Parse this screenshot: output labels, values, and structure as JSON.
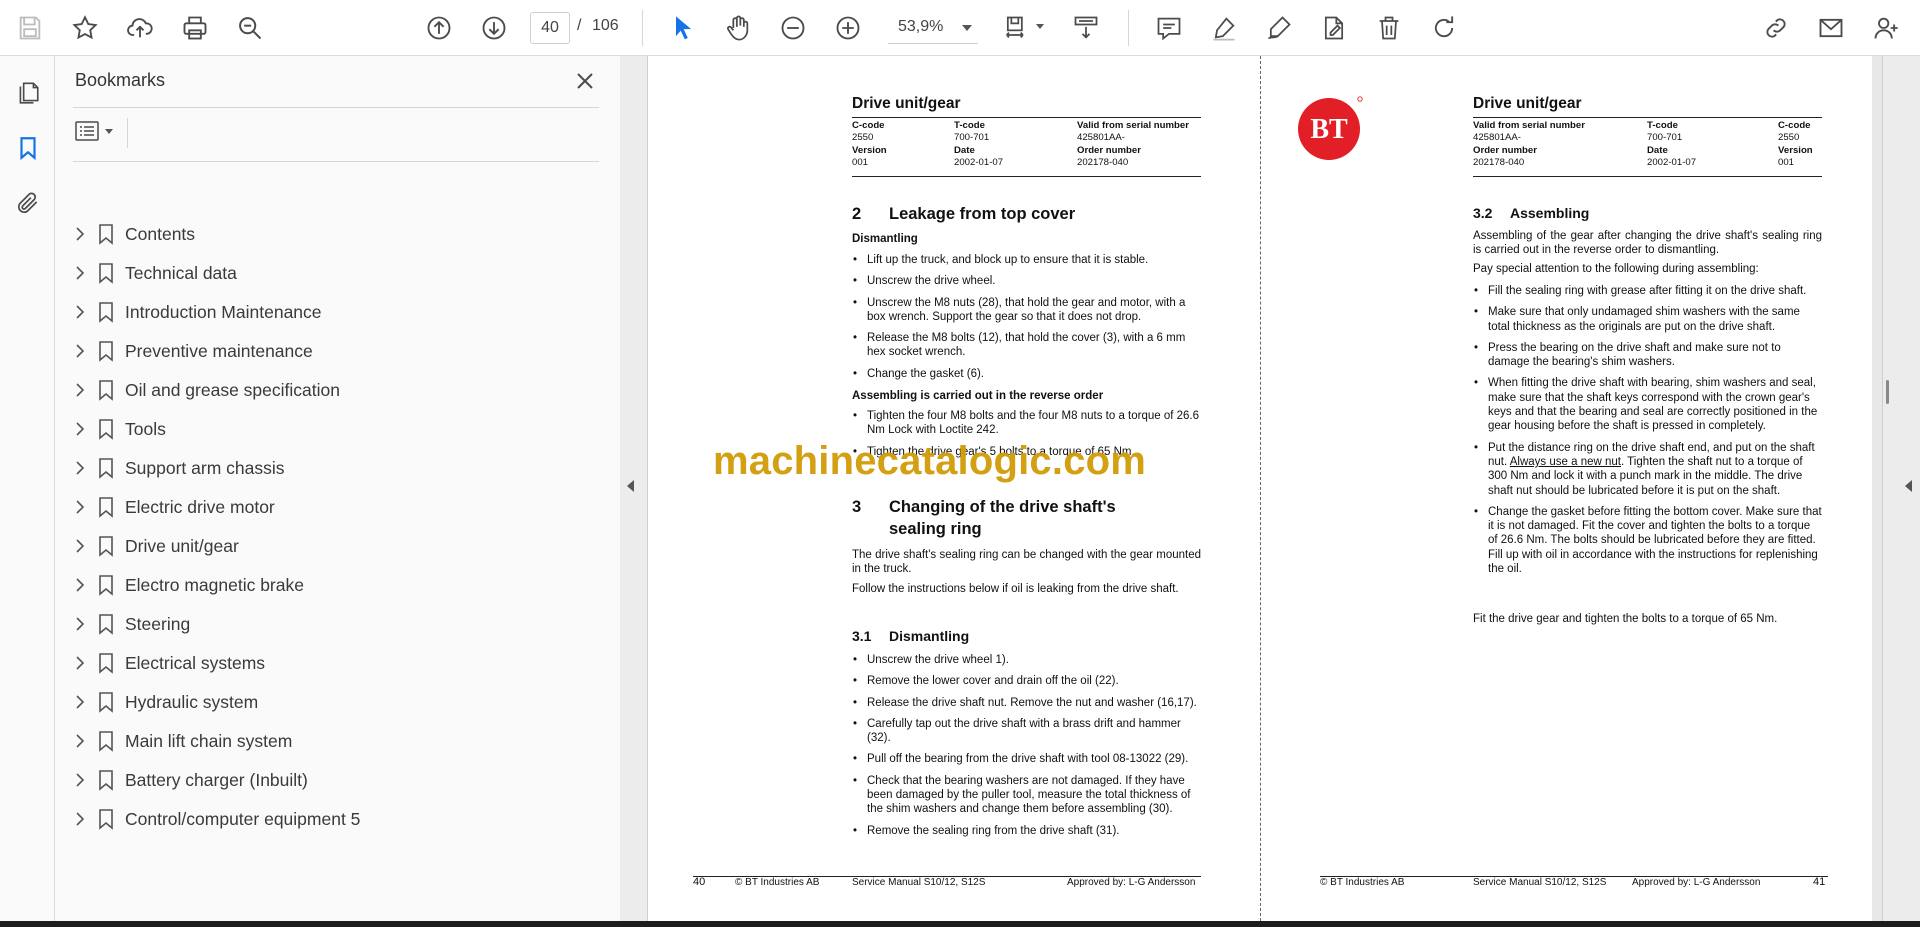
{
  "toolbar": {
    "page_current": "40",
    "page_sep": "/",
    "page_total": "106",
    "zoom": "53,9%"
  },
  "panel": {
    "title": "Bookmarks"
  },
  "bookmarks": [
    {
      "label": "Contents"
    },
    {
      "label": "Technical data"
    },
    {
      "label": "Introduction Maintenance"
    },
    {
      "label": "Preventive maintenance"
    },
    {
      "label": "Oil and grease specification"
    },
    {
      "label": "Tools"
    },
    {
      "label": "Support arm chassis"
    },
    {
      "label": "Electric drive motor"
    },
    {
      "label": "Drive unit/gear"
    },
    {
      "label": "Electro magnetic brake"
    },
    {
      "label": "Steering"
    },
    {
      "label": "Electrical systems"
    },
    {
      "label": "Hydraulic system"
    },
    {
      "label": "Main lift chain system"
    },
    {
      "label": "Battery charger (Inbuilt)"
    },
    {
      "label": "Control/computer equipment 5"
    }
  ],
  "left_page": {
    "title": "Drive unit/gear",
    "hdr": {
      "c_code_label": "C-code",
      "t_code_label": "T-code",
      "valid_label": "Valid from serial number",
      "c_code": "2550",
      "t_code": "700-701",
      "valid": "425801AA-",
      "version_label": "Version",
      "date_label": "Date",
      "order_label": "Order number",
      "version": "001",
      "date": "2002-01-07",
      "order": "202178-040"
    },
    "s2_num": "2",
    "s2_title": "Leakage from top cover",
    "dismantling": "Dismantling",
    "s2_bullets": [
      "Lift up the truck, and block up to ensure that it is stable.",
      "Unscrew the drive wheel.",
      "Unscrew the M8 nuts (28), that hold the gear and motor, with a box wrench. Support the gear so that it does not drop.",
      "Release the M8 bolts (12), that hold the cover (3), with a 6 mm hex socket wrench.",
      "Change the gasket (6)."
    ],
    "assembling_rev": "Assembling is carried out in the reverse order",
    "s2_bullets_b": [
      "Tighten the four M8 bolts and the four M8 nuts to a torque of 26.6 Nm Lock with Loctite 242.",
      "Tighten the drive gear's 5 bolts to a torque of 65 Nm."
    ],
    "s3_num": "3",
    "s3_title": "Changing of the drive shaft's sealing ring",
    "s3_p1": "The drive shaft's sealing ring can be changed with the gear mounted in the truck.",
    "s3_p2": "Follow the instructions below if oil is leaking from the drive shaft.",
    "s31_num": "3.1",
    "s31_title": "Dismantling",
    "s31_bullets": [
      "Unscrew the drive wheel 1).",
      "Remove the lower cover and drain off the oil (22).",
      "Release the drive shaft nut. Remove the nut and washer (16,17).",
      "Carefully tap out the drive shaft with a brass drift and hammer (32).",
      "Pull off the bearing from the drive shaft with tool 08-13022 (29).",
      "Check that the bearing washers are not damaged. If they have been damaged by the puller tool, measure the total thickness of the shim washers and change them before assembling (30).",
      "Remove the sealing ring from the drive shaft (31)."
    ],
    "footer": {
      "page": "40",
      "company": "© BT Industries AB",
      "manual": "Service Manual S10/12, S12S",
      "approved": "Approved by: L-G Andersson"
    }
  },
  "right_page": {
    "logo_text": "BT",
    "title": "Drive unit/gear",
    "hdr": {
      "valid_label": "Valid from serial number",
      "t_code_label": "T-code",
      "c_code_label": "C-code",
      "valid": "425801AA-",
      "t_code": "700-701",
      "c_code": "2550",
      "order_label": "Order number",
      "date_label": "Date",
      "version_label": "Version",
      "order": "202178-040",
      "date": "2002-01-07",
      "version": "001"
    },
    "s32_num": "3.2",
    "s32_title": "Assembling",
    "s32_p1": "Assembling of the gear after changing the drive shaft's sealing ring is carried out in the reverse order to dismantling.",
    "s32_p2": "Pay special attention to the following during assembling:",
    "b1": "Fill the sealing ring with grease after fitting it on the drive shaft.",
    "b2": "Make sure that only undamaged shim washers with the same total thickness as the originals are put on the drive shaft.",
    "b3": "Press the bearing on the drive shaft and make sure not to damage the bearing's shim washers.",
    "b4": "When fitting the drive shaft with bearing, shim washers and seal, make sure that the shaft keys correspond with the crown gear's keys and that the bearing and seal are correctly positioned in the gear housing before the shaft is pressed in completely.",
    "b5_a": "Put the distance ring on the drive shaft end, and put on the shaft nut. ",
    "b5_u": "Always use a new nut",
    "b5_b": ". Tighten the shaft nut to a torque of 300 Nm and lock it with a punch mark in the middle. The drive shaft nut should be lubricated before it is put on the shaft.",
    "b6": "Change the gasket before fitting the bottom cover. Make sure that it is not damaged. Fit the cover and tighten the bolts to a torque of 26.6 Nm. The bolts should be lubricated before they are fitted. Fill up with oil in accordance with the instructions for replenishing the oil.",
    "s32_p3": "Fit the drive gear and tighten the bolts to a torque of 65 Nm.",
    "footer": {
      "company": "© BT Industries AB",
      "manual": "Service Manual S10/12, S12S",
      "approved": "Approved by: L-G Andersson",
      "page": "41"
    }
  },
  "watermark": "machinecatalogic.com",
  "colors": {
    "accent_blue": "#1473e6",
    "watermark": "#d39d0a",
    "logo_red": "#e21e26",
    "icon_gray": "#4b4b4b"
  }
}
